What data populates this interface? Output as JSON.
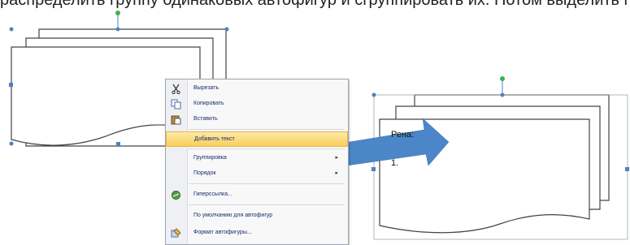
{
  "page": {
    "top_text": "распределить группу одинаковых автофигур и сгруппировать их. Потом выделить группу одинаковых"
  },
  "context_menu": {
    "items": [
      {
        "label": "Вырезать",
        "icon": "scissors-icon"
      },
      {
        "label": "Копировать",
        "icon": "copy-icon"
      },
      {
        "label": "Вставить",
        "icon": "paste-icon"
      },
      {
        "label": "Добавить текст",
        "icon": "",
        "highlighted": true
      },
      {
        "label": "Группировка",
        "icon": "",
        "submenu_arrow": "▸"
      },
      {
        "label": "Порядок",
        "icon": "",
        "submenu_arrow": "▸"
      },
      {
        "label": "Гиперссылка...",
        "icon": "hyperlink-icon"
      },
      {
        "label": "По умолчанию для автофигур",
        "icon": ""
      },
      {
        "label": "Формат автофигуры...",
        "icon": "format-shape-icon"
      }
    ]
  },
  "result_shape": {
    "text_line1": "Рена:",
    "text_line2": "1."
  },
  "colors": {
    "shape_stroke": "#444444",
    "handle_blue": "#4f81bd",
    "rotate_handle": "#3cb34a",
    "arrow_blue": "#4a86c8",
    "highlight": "#f8cf5b"
  }
}
